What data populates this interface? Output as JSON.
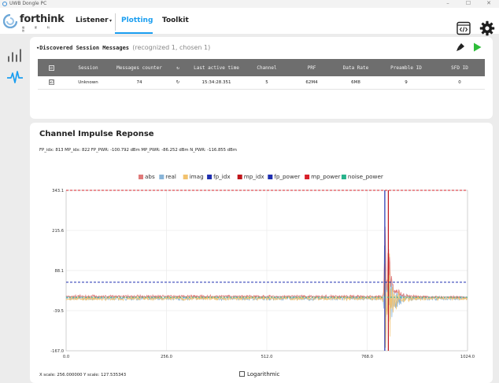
{
  "window": {
    "title": "UWB Dongle PC",
    "min": "–",
    "max": "☐",
    "close": "✕"
  },
  "brand": {
    "name": "forthink",
    "sub": "福 斯 科 技"
  },
  "nav": {
    "listener": "Listener",
    "plotting": "Plotting",
    "toolkit": "Toolkit",
    "arrow": "▾"
  },
  "colors": {
    "accent": "#1a9ef0",
    "play": "#2ebd3a",
    "header_bg": "#6e6e6e"
  },
  "sessions": {
    "title": "▾Discovered Session Messages",
    "note": "(recognized 1, chosen 1)",
    "columns": [
      "Session",
      "Messages counter",
      "↻",
      "Last active time",
      "Channel",
      "PRF",
      "Data Rate",
      "Preamble ID",
      "SFD ID"
    ],
    "rows": [
      {
        "session": "Unknown",
        "counter": "74",
        "refresh": "↻",
        "last_active": "15:34:28.351",
        "channel": "5",
        "prf": "62M4",
        "data_rate": "6M8",
        "preamble": "9",
        "sfd": "0"
      }
    ],
    "check": "☑"
  },
  "cir": {
    "title": "Channel Impulse Reponse",
    "stats": "FP_idx: 813  MP_idx: 822  FP_PWR: -100.792 dBm  MP_PWR: -86.252 dBm  N_PWR: -116.855 dBm",
    "scale": "X scale: 256.000000  Y scale: 127.535343",
    "log_label": "Logarithmic"
  },
  "chart_data": {
    "type": "line",
    "x_ticks": [
      "0.0",
      "256.0",
      "512.0",
      "768.0",
      "1024.0"
    ],
    "y_ticks": [
      "343.1",
      "215.6",
      "88.1",
      "-39.5",
      "-167.0"
    ],
    "xlim": [
      0,
      1024
    ],
    "ylim": [
      -167.0,
      343.1
    ],
    "legend_position": "top-center",
    "series": [
      {
        "name": "abs",
        "color": "#e07a7a"
      },
      {
        "name": "real",
        "color": "#88b4d8"
      },
      {
        "name": "imag",
        "color": "#f2c26e"
      },
      {
        "name": "fp_idx",
        "color": "#1f2fb0",
        "kind": "vline",
        "value": 813
      },
      {
        "name": "mp_idx",
        "color": "#c0151b",
        "kind": "vline",
        "value": 822
      },
      {
        "name": "fp_power",
        "color": "#1f2fb0",
        "kind": "hline",
        "value": 51.0
      },
      {
        "name": "mp_power",
        "color": "#d8202a",
        "kind": "hline",
        "value": 343.1
      },
      {
        "name": "noise_power",
        "color": "#27b38c",
        "kind": "hline",
        "value": 3.0
      }
    ],
    "noise_level": 5.0,
    "pulse": [
      [
        805,
        0
      ],
      [
        808,
        20
      ],
      [
        811,
        60
      ],
      [
        813,
        180
      ],
      [
        815,
        140
      ],
      [
        817,
        60
      ],
      [
        819,
        40
      ],
      [
        822,
        150
      ],
      [
        825,
        110
      ],
      [
        828,
        80
      ],
      [
        832,
        55
      ],
      [
        836,
        40
      ],
      [
        842,
        28
      ],
      [
        850,
        18
      ],
      [
        860,
        12
      ],
      [
        875,
        8
      ],
      [
        900,
        6
      ],
      [
        930,
        5
      ],
      [
        1024,
        5
      ]
    ]
  }
}
